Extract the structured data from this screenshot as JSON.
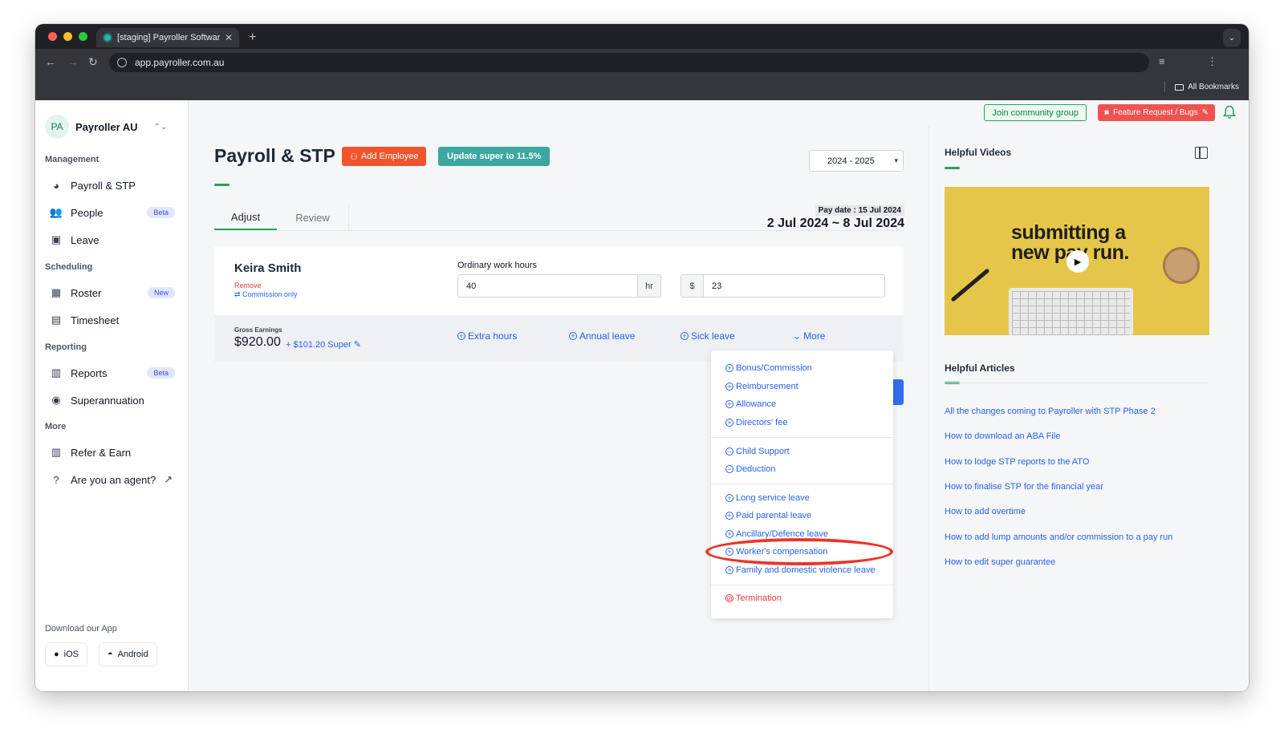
{
  "browser": {
    "tab_title": "[staging] Payroller Software",
    "url": "app.payroller.com.au",
    "bookmarks_label": "All Bookmarks"
  },
  "sidebar": {
    "org_initials": "PA",
    "org_name": "Payroller AU",
    "sections": {
      "management": "Management",
      "scheduling": "Scheduling",
      "reporting": "Reporting",
      "more": "More"
    },
    "items": [
      {
        "label": "Payroll & STP",
        "icon": "payroll-icon"
      },
      {
        "label": "People",
        "icon": "people-icon",
        "badge": "Beta"
      },
      {
        "label": "Leave",
        "icon": "briefcase-icon"
      },
      {
        "label": "Roster",
        "icon": "calendar-icon",
        "badge": "New"
      },
      {
        "label": "Timesheet",
        "icon": "timesheet-icon"
      },
      {
        "label": "Reports",
        "icon": "reports-icon",
        "badge": "Beta"
      },
      {
        "label": "Superannuation",
        "icon": "piggy-bank-icon"
      },
      {
        "label": "Refer & Earn",
        "icon": "refer-icon"
      },
      {
        "label": "Are you an agent?",
        "icon": "help-circle-icon"
      }
    ],
    "download_label": "Download our App",
    "ios_label": "iOS",
    "android_label": "Android"
  },
  "topbar": {
    "community_label": "Join community group",
    "feature_label": "Feature Request / Bugs"
  },
  "page": {
    "title": "Payroll & STP",
    "add_employee_label": "Add Employee",
    "update_super_label": "Update super to 11.5%",
    "year_select": "2024 - 2025",
    "tabs": [
      "Adjust",
      "Review"
    ],
    "pay_date": "Pay date : 15 Jul 2024",
    "pay_range": "2 Jul 2024 ~ 8 Jul 2024"
  },
  "employee": {
    "name": "Keira Smith",
    "remove_label": "Remove",
    "commission_label": "⇄ Commission only",
    "hours_label": "Ordinary work hours",
    "hours_value": "40",
    "hours_unit": "hr",
    "rate_currency": "$",
    "rate_value": "23",
    "gross_label": "Gross Earnings",
    "gross_value": "$920.00",
    "super_label": "+ $101.20 Super",
    "earn_links": [
      "Extra hours",
      "Annual leave",
      "Sick leave"
    ],
    "more_label": "More"
  },
  "more_menu": {
    "group1": [
      "Bonus/Commission",
      "Reimbursement",
      "Allowance",
      "Directors' fee"
    ],
    "group2": [
      "Child Support",
      "Deduction"
    ],
    "group3": [
      "Long service leave",
      "Paid parental leave",
      "Ancillary/Defence leave",
      "Worker's compensation",
      "Family and domestic violence leave"
    ],
    "termination_label": "Termination"
  },
  "right_panel": {
    "videos_title": "Helpful Videos",
    "video_text_line1": "submitting a",
    "video_text_line2": "new pay run.",
    "articles_title": "Helpful Articles",
    "articles": [
      "All the changes coming to Payroller with STP Phase 2",
      "How to download an ABA File",
      "How to lodge STP reports to the ATO",
      "How to finalise STP for the financial year",
      "How to add overtime",
      "How to add lump amounts and/or commission to a pay run",
      "How to edit super guarantee"
    ]
  },
  "colors": {
    "accent_green": "#22a35c",
    "add_employee": "#f0542d",
    "update_super": "#3ba8a0",
    "link_blue": "#2563eb",
    "danger_red": "#e53935",
    "highlight_ellipse": "#e8372c"
  }
}
